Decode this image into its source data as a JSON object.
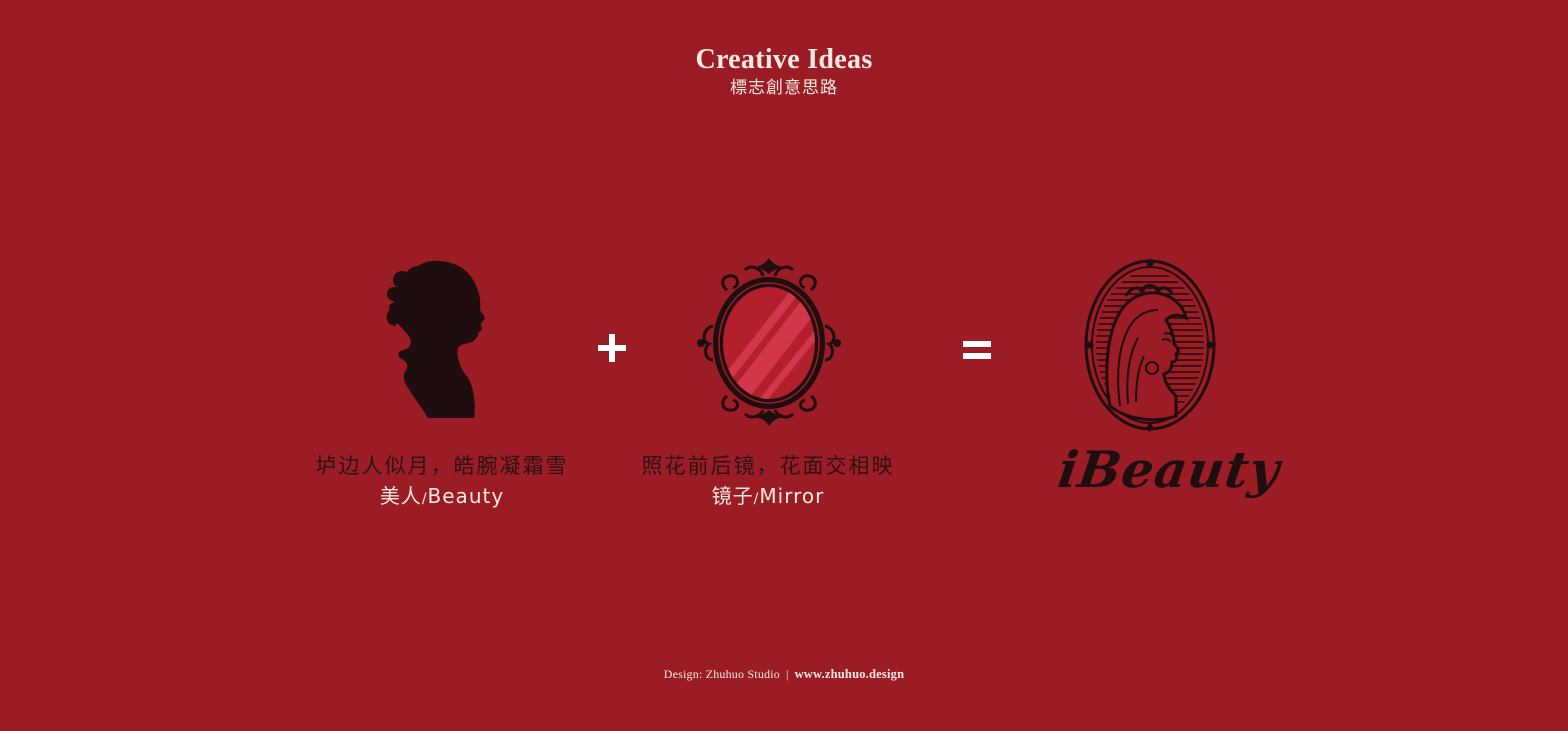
{
  "header": {
    "title": "Creative Ideas",
    "subtitle": "標志創意思路"
  },
  "items": [
    {
      "poem": "垆边人似月，皓腕凝霜雪",
      "label_cn": "美人",
      "label_en": "Beauty",
      "icon": "woman-silhouette-icon"
    },
    {
      "poem": "照花前后镜，花面交相映",
      "label_cn": "镜子",
      "label_en": "Mirror",
      "icon": "ornate-mirror-icon"
    }
  ],
  "operators": {
    "plus": "+",
    "equals": "="
  },
  "result": {
    "wordmark": "iBeauty",
    "icon": "ibeauty-logo-emblem"
  },
  "footer": {
    "credit": "Design: Zhuhuo Studio",
    "separator": "|",
    "url": "www.zhuhuo.design"
  },
  "colors": {
    "background": "#9b1c25",
    "dark": "#1f0d0f",
    "light": "#f6e9e2"
  }
}
